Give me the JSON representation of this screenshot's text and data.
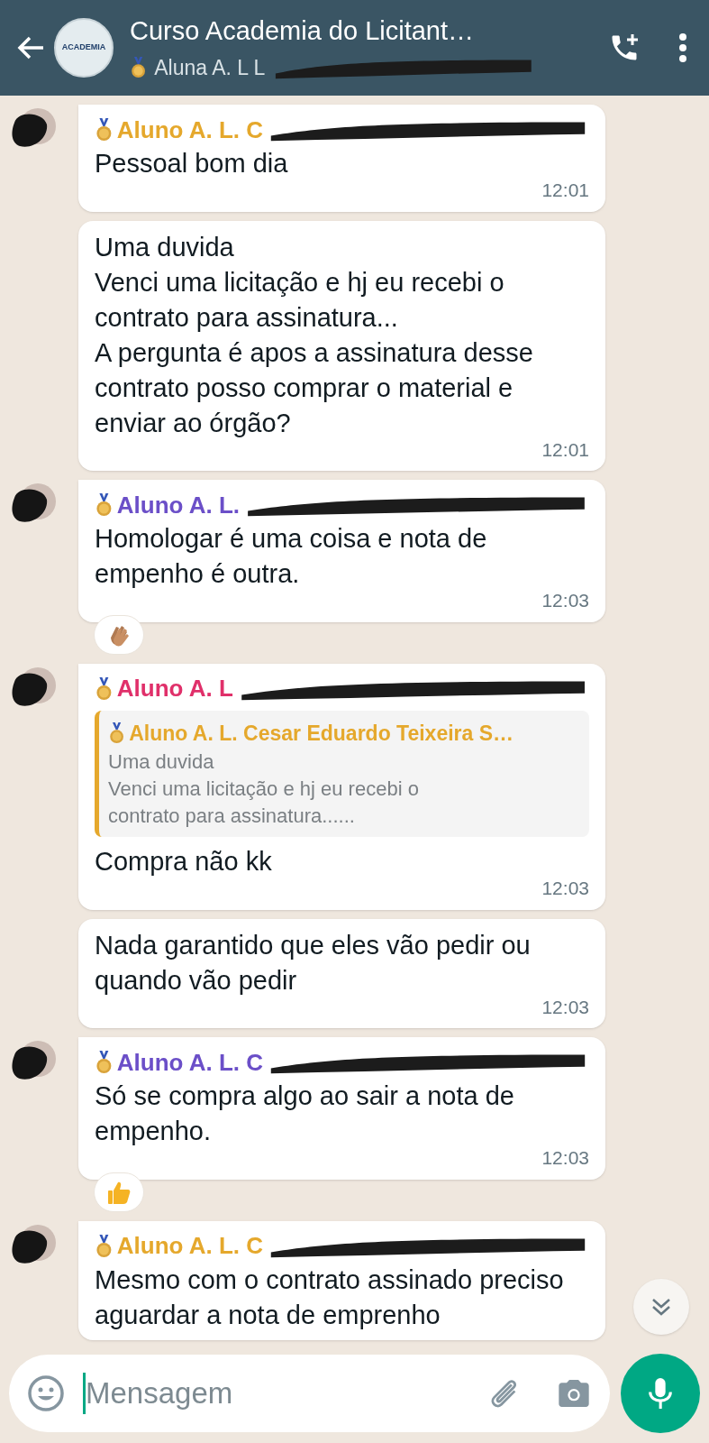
{
  "header": {
    "title": "Curso Academia do Licitant…",
    "logo_text": "ACADEMIA",
    "subtitle": "Aluna A. L L",
    "subtitle_redacted": true
  },
  "messages": [
    {
      "sender": {
        "name": "Aluno A. L. C",
        "color": "#e5a82c",
        "redacted": true
      },
      "text": "Pessoal bom dia",
      "time": "12:01"
    },
    {
      "text": "Uma duvida\nVenci uma licitação e hj eu recebi o contrato para assinatura...\nA pergunta é apos a assinatura desse contrato posso comprar o material e enviar ao órgão?",
      "time": "12:01"
    },
    {
      "sender": {
        "name": "Aluno A. L.",
        "color": "#6b4fc8",
        "redacted": true
      },
      "text": "Homologar é uma coisa e nota de empenho é outra.",
      "time": "12:03",
      "reaction": {
        "kind": "clap"
      }
    },
    {
      "sender": {
        "name": "Aluno A. L",
        "color": "#e0306a",
        "redacted": true
      },
      "quote": {
        "name": "Aluno A. L. Cesar Eduardo Teixeira S…",
        "color": "#e5a82c",
        "text": "Uma duvida\nVenci uma licitação e hj eu recebi o\ncontrato para assinatura......"
      },
      "text": "Compra não kk",
      "time": "12:03"
    },
    {
      "text": "Nada garantido que eles vão pedir ou quando vão pedir",
      "time": "12:03"
    },
    {
      "sender": {
        "name": "Aluno A. L. C",
        "color": "#6b4fc8",
        "redacted": true
      },
      "text": "Só se compra algo ao sair a nota de empenho.",
      "time": "12:03",
      "reaction": {
        "kind": "thumbs_up"
      }
    },
    {
      "sender": {
        "name": "Aluno A. L. C",
        "color": "#e5a82c",
        "redacted": true
      },
      "text": "Mesmo com o contrato assinado preciso aguardar a nota de emprenho"
    }
  ],
  "composer": {
    "placeholder": "Mensagem"
  }
}
